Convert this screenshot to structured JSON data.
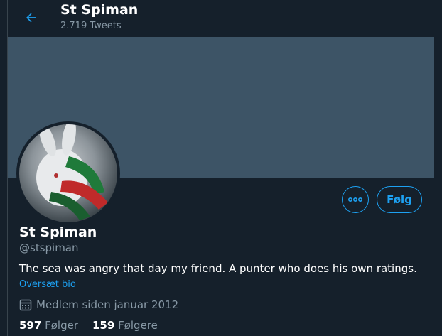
{
  "header": {
    "name": "St Spiman",
    "tweet_count": "2.719 Tweets"
  },
  "icons": {
    "back": "arrow-left-icon",
    "more": "more-icon",
    "calendar": "calendar-icon"
  },
  "actions": {
    "follow_label": "Følg"
  },
  "profile": {
    "name": "St Spiman",
    "handle": "@stspiman",
    "bio": "The sea was angry that day my friend. A punter who does his own ratings.",
    "translate_label": "Oversæt bio",
    "joined": "Medlem siden januar 2012"
  },
  "stats": {
    "following_count": "597",
    "following_label": "Følger",
    "followers_count": "159",
    "followers_label": "Følgere"
  },
  "colors": {
    "background": "#15202b",
    "banner": "#3d5466",
    "accent": "#1da1f2",
    "muted": "#8899a6"
  }
}
